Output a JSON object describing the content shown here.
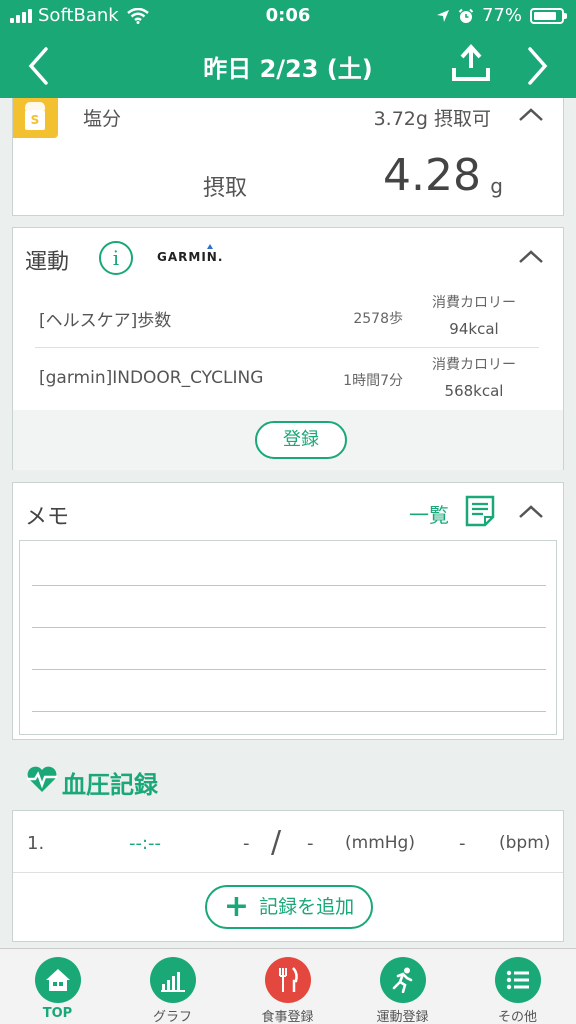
{
  "status_bar": {
    "carrier": "SoftBank",
    "time": "0:06",
    "battery": "77%"
  },
  "nav": {
    "title": "昨日 2/23 (土)"
  },
  "salt": {
    "label": "塩分",
    "available": "3.72g 摂取可",
    "intake_label": "摂取",
    "intake_value": "4.28",
    "intake_unit": "g"
  },
  "exercise": {
    "title": "運動",
    "brand": "GARMIN.",
    "rows": [
      {
        "name": "[ヘルスケア]歩数",
        "amount": "2578歩",
        "cal_label": "消費カロリー",
        "cal_value": "94kcal"
      },
      {
        "name": "[garmin]INDOOR_CYCLING",
        "amount": "1時間7分",
        "cal_label": "消費カロリー",
        "cal_value": "568kcal"
      }
    ],
    "register_label": "登録"
  },
  "memo": {
    "title": "メモ",
    "list_label": "一覧"
  },
  "blood_pressure": {
    "title": "血圧記録",
    "row": {
      "index": "1.",
      "time": "--:--",
      "systolic": "-",
      "slash": "/",
      "diastolic": "-",
      "bp_unit": "(mmHg)",
      "pulse": "-",
      "pulse_unit": "(bpm)"
    },
    "add_label": "記録を追加"
  },
  "tabs": [
    {
      "label": "TOP",
      "icon": "home-icon"
    },
    {
      "label": "グラフ",
      "icon": "bar-chart-icon"
    },
    {
      "label": "食事登録",
      "icon": "fork-knife-icon"
    },
    {
      "label": "運動登録",
      "icon": "running-icon"
    },
    {
      "label": "その他",
      "icon": "list-icon"
    }
  ],
  "colors": {
    "brand": "#1aa877",
    "meal": "#e4473d",
    "salt": "#f3c030"
  }
}
